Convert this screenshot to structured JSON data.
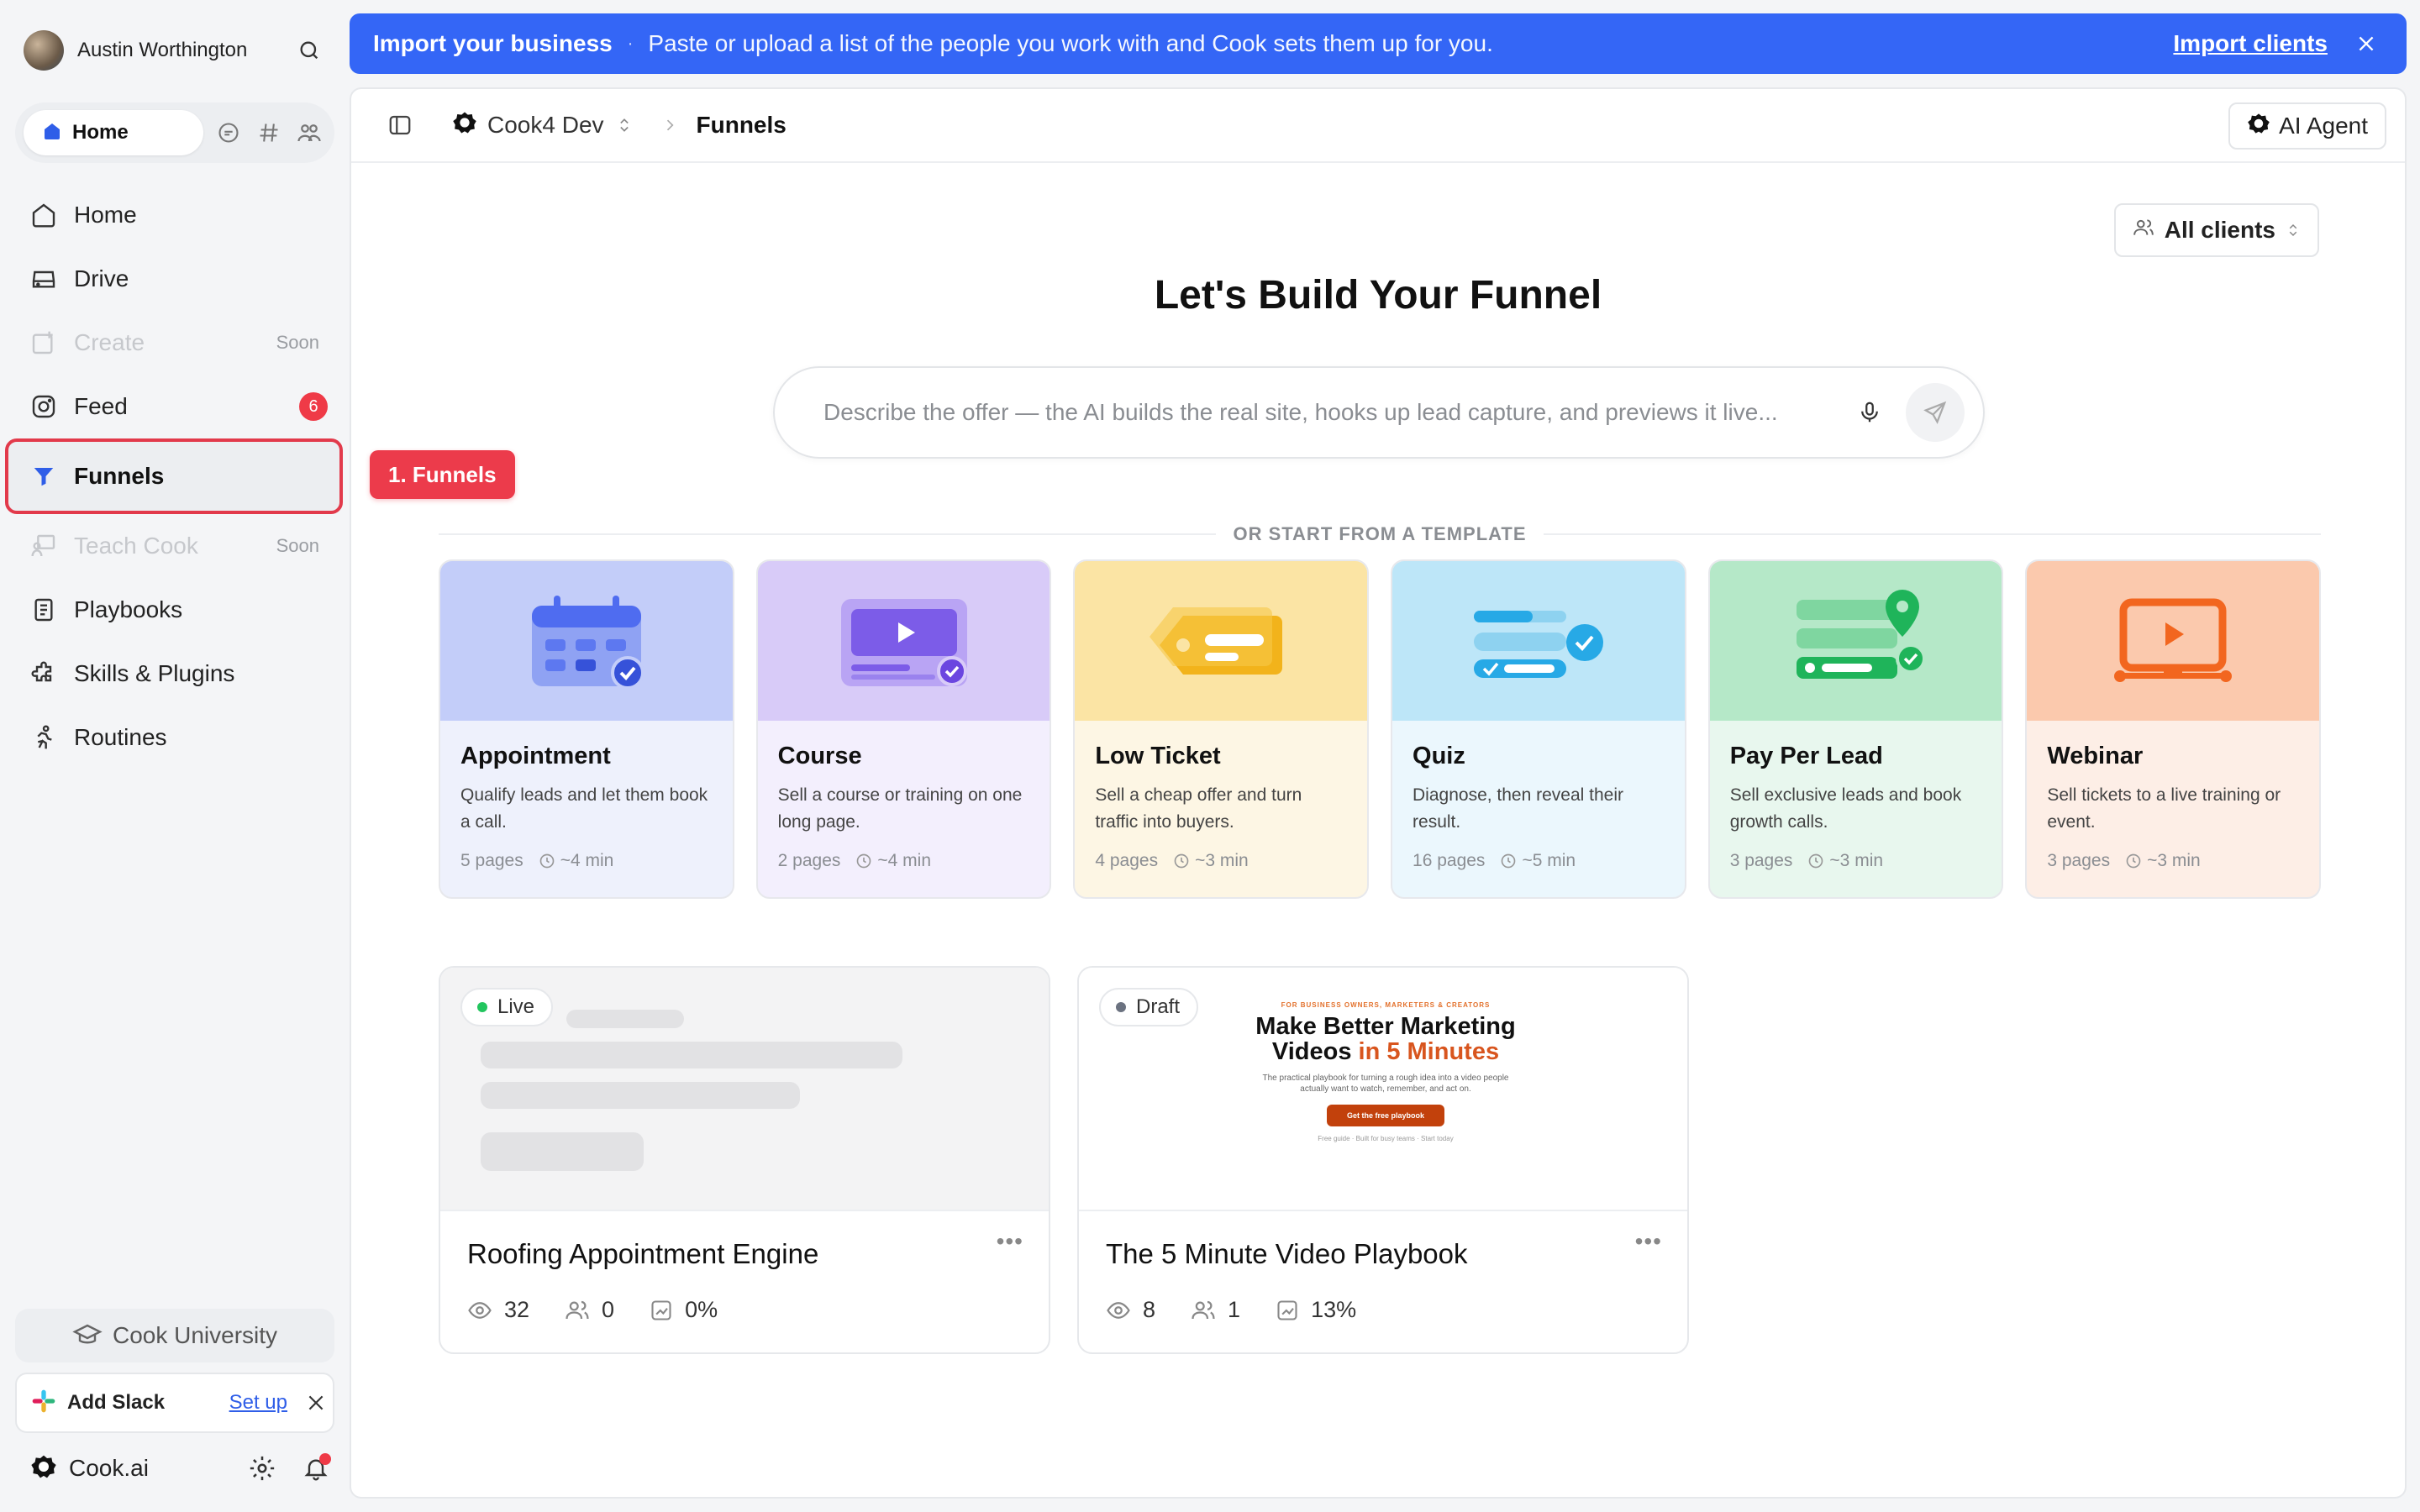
{
  "user": {
    "name": "Austin Worthington"
  },
  "home_pill": {
    "label": "Home"
  },
  "nav": {
    "home": "Home",
    "drive": "Drive",
    "create": "Create",
    "create_tag": "Soon",
    "feed": "Feed",
    "feed_badge": "6",
    "funnels": "Funnels",
    "teach": "Teach Cook",
    "teach_tag": "Soon",
    "playbooks": "Playbooks",
    "skills": "Skills & Plugins",
    "routines": "Routines"
  },
  "university": {
    "label": "Cook University"
  },
  "slack": {
    "label": "Add Slack",
    "action": "Set up"
  },
  "brand": {
    "label": "Cook.ai"
  },
  "banner": {
    "title": "Import your business",
    "separator": "·",
    "text": "Paste or upload a list of the people you work with and Cook sets them up for you.",
    "link": "Import clients"
  },
  "topbar": {
    "workspace": "Cook4 Dev",
    "page": "Funnels",
    "ai_agent": "AI Agent"
  },
  "filter": {
    "label": "All clients"
  },
  "hero": {
    "title": "Let's Build Your Funnel",
    "placeholder": "Describe the offer — the AI builds the real site, hooks up lead capture, and previews it live..."
  },
  "templates_heading": "OR START FROM A TEMPLATE",
  "templates": [
    {
      "title": "Appointment",
      "desc": "Qualify leads and let them book a call.",
      "pages": "5 pages",
      "time": "~4 min"
    },
    {
      "title": "Course",
      "desc": "Sell a course or training on one long page.",
      "pages": "2 pages",
      "time": "~4 min"
    },
    {
      "title": "Low Ticket",
      "desc": "Sell a cheap offer and turn traffic into buyers.",
      "pages": "4 pages",
      "time": "~3 min"
    },
    {
      "title": "Quiz",
      "desc": "Diagnose, then reveal their result.",
      "pages": "16 pages",
      "time": "~5 min"
    },
    {
      "title": "Pay Per Lead",
      "desc": "Sell exclusive leads and book growth calls.",
      "pages": "3 pages",
      "time": "~3 min"
    },
    {
      "title": "Webinar",
      "desc": "Sell tickets to a live training or event.",
      "pages": "3 pages",
      "time": "~3 min"
    }
  ],
  "funnels": [
    {
      "status": "Live",
      "title": "Roofing Appointment Engine",
      "views": "32",
      "leads": "0",
      "conversion": "0%"
    },
    {
      "status": "Draft",
      "title": "The 5 Minute Video Playbook",
      "views": "8",
      "leads": "1",
      "conversion": "13%"
    }
  ],
  "mini_preview": {
    "eyebrow": "FOR BUSINESS OWNERS, MARKETERS & CREATORS",
    "headline_1": "Make Better Marketing",
    "headline_2a": "Videos",
    "headline_2b": "in 5 Minutes",
    "sub": "The practical playbook for turning a rough idea into a video people actually want to watch, remember, and act on.",
    "cta": "Get the free playbook",
    "foot": "Free guide · Built for busy teams · Start today"
  },
  "annotation": {
    "label": "1. Funnels"
  },
  "colors": {
    "accent": "#3466f6",
    "highlight": "#e23a4b",
    "live": "#22c55e",
    "draft": "#6b7280"
  }
}
